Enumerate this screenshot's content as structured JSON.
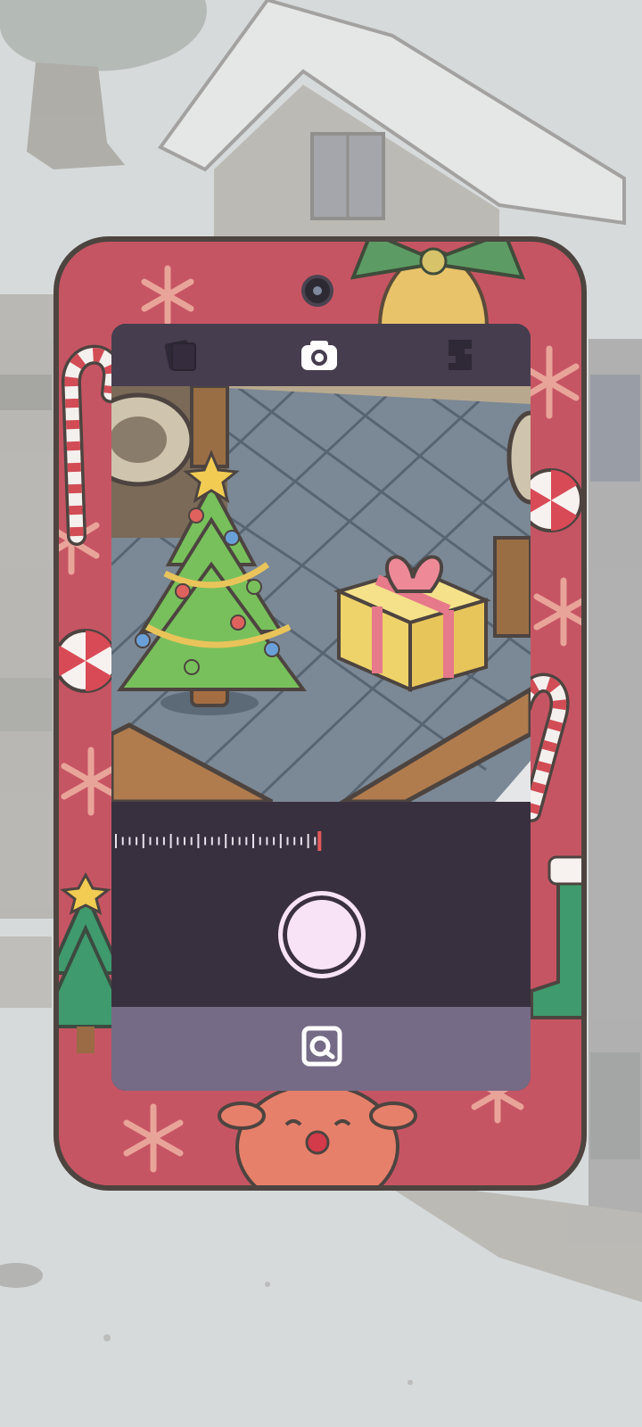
{
  "scene": {
    "colors": {
      "background": "#d6dadb",
      "phone_case": "#c65563",
      "phone_border": "#4d4440",
      "screen_dark": "#39303f",
      "topbar": "#463d4f",
      "bottombar": "#766b86",
      "shutter": "#f8e2f6",
      "zoom_marker": "#e35a5a"
    }
  },
  "phone": {
    "theme": "christmas",
    "decorations": [
      "snowflake-icon",
      "bell-icon",
      "candy-cane-icon",
      "peppermint-candy-icon",
      "christmas-tree-icon",
      "reindeer-icon",
      "stocking-icon"
    ]
  },
  "camera_app": {
    "top_tabs": [
      {
        "icon": "photo-album-icon",
        "active": false
      },
      {
        "icon": "camera-icon",
        "active": true
      },
      {
        "icon": "frame-sticker-icon",
        "active": false
      }
    ],
    "viewfinder": {
      "objects": [
        "christmas-tree",
        "gift-box",
        "plant-pot",
        "wooden-counter"
      ]
    },
    "zoom": {
      "level": 1.0,
      "ticks": 30
    },
    "shutter_icon": "shutter-button",
    "bottom_icon": "switch-lens-icon"
  }
}
